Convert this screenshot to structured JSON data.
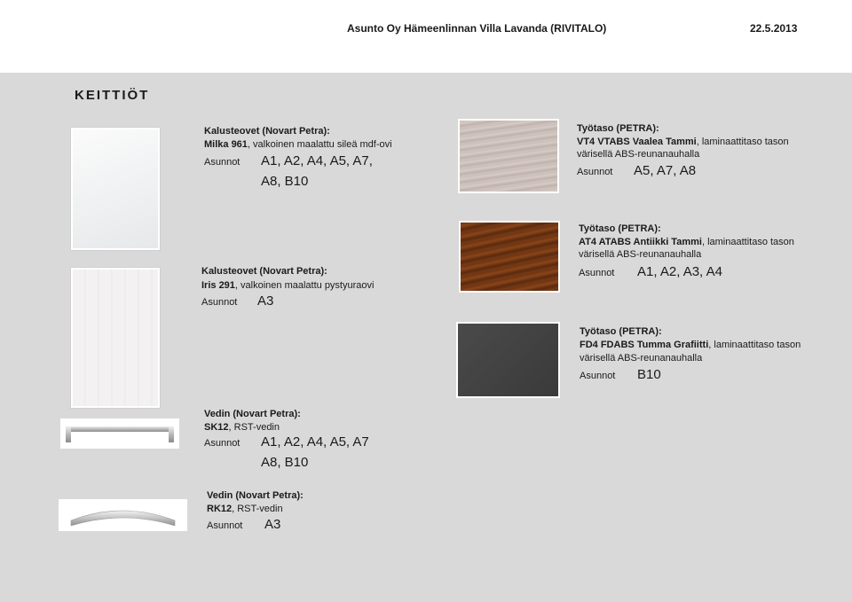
{
  "header": {
    "title": "Asunto Oy Hämeenlinnan Villa Lavanda (RIVITALO)",
    "date": "22.5.2013"
  },
  "section_title": "KEITTIÖT",
  "items": {
    "milka": {
      "heading": "Kalusteovet (Novart Petra):",
      "name": "Milka 961",
      "desc": ", valkoinen maalattu sileä mdf-ovi",
      "label": "Asunnot",
      "units_line1": "A1, A2, A4, A5, A7,",
      "units_line2": "A8, B10"
    },
    "iris": {
      "heading": "Kalusteovet (Novart Petra):",
      "name": "Iris 291",
      "desc": ", valkoinen maalattu pystyuraovi",
      "label": "Asunnot",
      "units": "A3"
    },
    "vt4": {
      "heading": "Työtaso (PETRA):",
      "name": "VT4 VTABS Vaalea Tammi",
      "desc": ", laminaattitaso tason",
      "desc2": "värisellä ABS-reunanauhalla",
      "label": "Asunnot",
      "units": "A5, A7, A8"
    },
    "at4": {
      "heading": "Työtaso (PETRA):",
      "name": "AT4 ATABS Antiikki Tammi",
      "desc": ", laminaattitaso tason",
      "desc2": "värisellä ABS-reunanauhalla",
      "label": "Asunnot",
      "units": "A1, A2, A3, A4"
    },
    "fd4": {
      "heading": "Työtaso (PETRA):",
      "name": "FD4 FDABS Tumma Grafiitti",
      "desc": ", laminaattitaso tason",
      "desc2": "värisellä ABS-reunanauhalla",
      "label": "Asunnot",
      "units": "B10"
    },
    "sk12": {
      "heading": "Vedin (Novart Petra):",
      "name": "SK12",
      "desc": ", RST-vedin",
      "label": "Asunnot",
      "units_line1": "A1, A2, A4, A5, A7",
      "units_line2": "A8, B10"
    },
    "rk12": {
      "heading": "Vedin (Novart Petra):",
      "name": "RK12",
      "desc": ", RST-vedin",
      "label": "Asunnot",
      "units": "A3"
    }
  }
}
